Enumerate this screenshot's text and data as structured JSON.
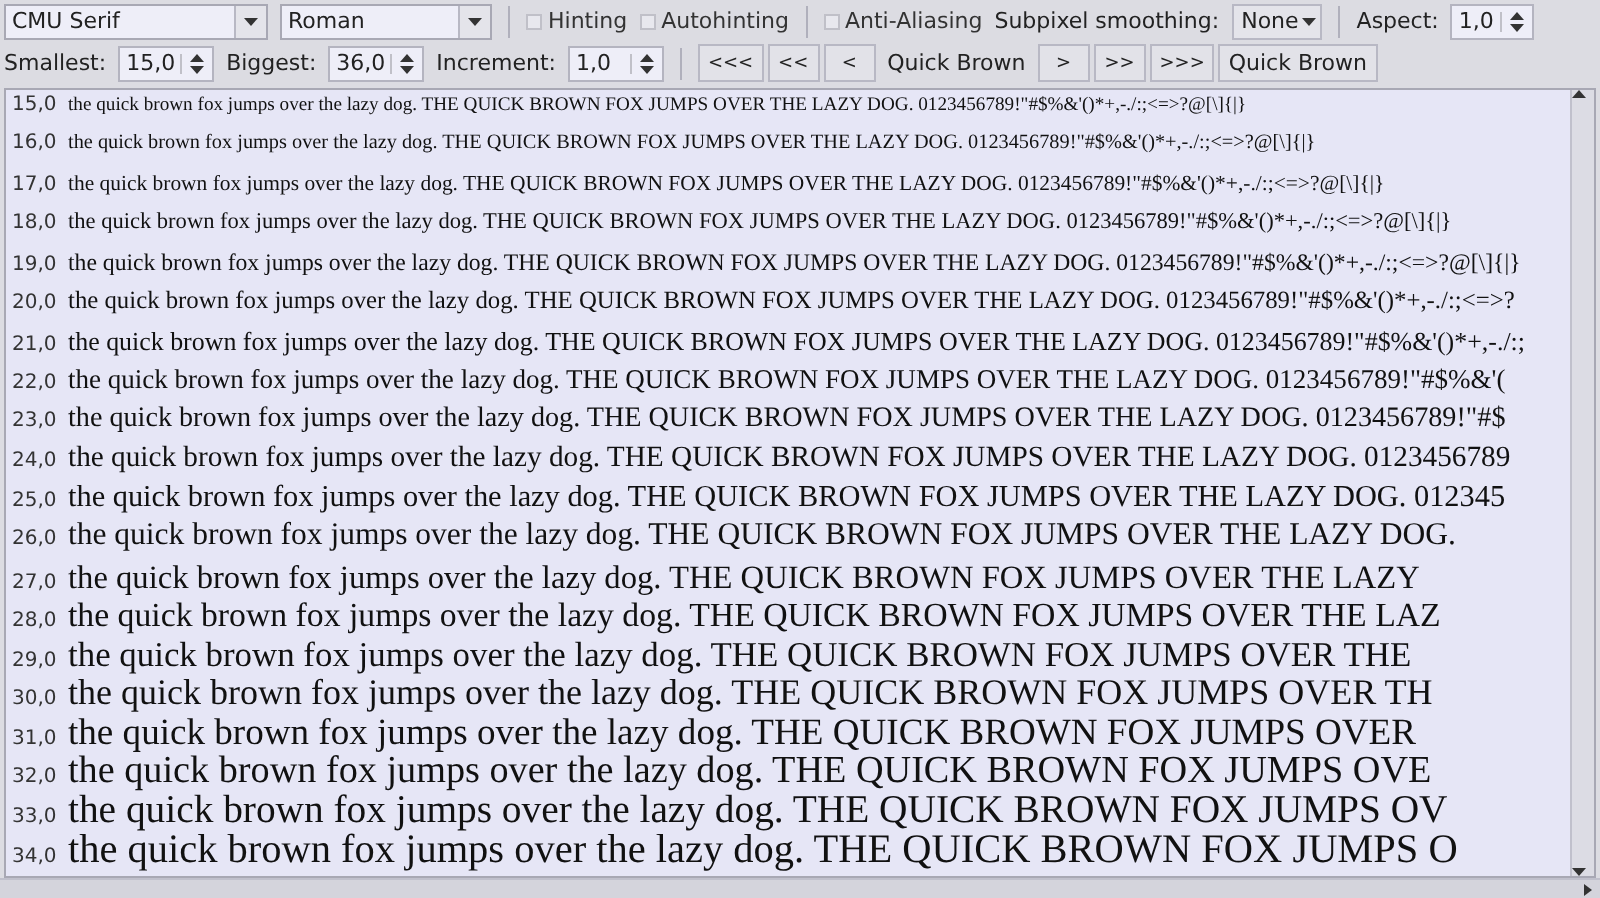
{
  "toolbar_top": {
    "font_combo": {
      "value": "CMU Serif"
    },
    "style_combo": {
      "value": "Roman"
    },
    "checkboxes": [
      {
        "label": "Hinting",
        "checked": false
      },
      {
        "label": "Autohinting",
        "checked": false
      },
      {
        "label": "Anti-Aliasing",
        "checked": false
      }
    ],
    "subpixel": {
      "label": "Subpixel smoothing:",
      "value": "None"
    },
    "aspect": {
      "label": "Aspect:",
      "value": "1,0"
    }
  },
  "toolbar_bottom": {
    "spinboxes": [
      {
        "label": "Smallest:",
        "value": "15,0"
      },
      {
        "label": "Biggest:",
        "value": "36,0"
      },
      {
        "label": "Increment:",
        "value": "1,0"
      }
    ],
    "back_buttons": [
      "<<<",
      "<<",
      "<"
    ],
    "sample_text": "Quick Brown",
    "forward_buttons": [
      ">",
      ">>",
      ">>>"
    ],
    "text_button": "Quick Brown"
  },
  "samples": [
    {
      "size": "15,0",
      "text": "the quick brown fox jumps over the lazy dog. THE QUICK BROWN FOX JUMPS OVER THE LAZY DOG. 0123456789!\"#$%&'()*+,-./:;<=>?@[\\]{|}"
    },
    {
      "size": "16,0",
      "text": "the quick brown fox jumps over the lazy dog. THE QUICK BROWN FOX JUMPS OVER THE LAZY DOG. 0123456789!\"#$%&'()*+,-./:;<=>?@[\\]{|}"
    },
    {
      "size": "17,0",
      "text": "the quick brown fox jumps over the lazy dog. THE QUICK BROWN FOX JUMPS OVER THE LAZY DOG. 0123456789!\"#$%&'()*+,-./:;<=>?@[\\]{|}"
    },
    {
      "size": "18,0",
      "text": "the quick brown fox jumps over the lazy dog. THE QUICK BROWN FOX JUMPS OVER THE LAZY DOG. 0123456789!\"#$%&'()*+,-./:;<=>?@[\\]{|}"
    },
    {
      "size": "19,0",
      "text": "the quick brown fox jumps over the lazy dog. THE QUICK BROWN FOX JUMPS OVER THE LAZY DOG. 0123456789!\"#$%&'()*+,-./:;<=>?@[\\]{|}"
    },
    {
      "size": "20,0",
      "text": "the quick brown fox jumps over the lazy dog. THE QUICK BROWN FOX JUMPS OVER THE LAZY DOG. 0123456789!\"#$%&'()*+,-./:;<=>?"
    },
    {
      "size": "21,0",
      "text": "the quick brown fox jumps over the lazy dog. THE QUICK BROWN FOX JUMPS OVER THE LAZY DOG. 0123456789!\"#$%&'()*+,-./:;"
    },
    {
      "size": "22,0",
      "text": "the quick brown fox jumps over the lazy dog. THE QUICK BROWN FOX JUMPS OVER THE LAZY DOG. 0123456789!\"#$%&'("
    },
    {
      "size": "23,0",
      "text": "the quick brown fox jumps over the lazy dog. THE QUICK BROWN FOX JUMPS OVER THE LAZY DOG. 0123456789!\"#$"
    },
    {
      "size": "24,0",
      "text": "the quick brown fox jumps over the lazy dog. THE QUICK BROWN FOX JUMPS OVER THE LAZY DOG. 0123456789"
    },
    {
      "size": "25,0",
      "text": "the quick brown fox jumps over the lazy dog. THE QUICK BROWN FOX JUMPS OVER THE LAZY DOG. 012345"
    },
    {
      "size": "26,0",
      "text": "the quick brown fox jumps over the lazy dog. THE QUICK BROWN FOX JUMPS OVER THE LAZY DOG."
    },
    {
      "size": "27,0",
      "text": "the quick brown fox jumps over the lazy dog. THE QUICK BROWN FOX JUMPS OVER THE LAZY"
    },
    {
      "size": "28,0",
      "text": "the quick brown fox jumps over the lazy dog. THE QUICK BROWN FOX JUMPS OVER THE LAZ"
    },
    {
      "size": "29,0",
      "text": "the quick brown fox jumps over the lazy dog. THE QUICK BROWN FOX JUMPS OVER THE"
    },
    {
      "size": "30,0",
      "text": "the quick brown fox jumps over the lazy dog. THE QUICK BROWN FOX JUMPS OVER TH"
    },
    {
      "size": "31,0",
      "text": "the quick brown fox jumps over the lazy dog. THE QUICK BROWN FOX JUMPS OVER"
    },
    {
      "size": "32,0",
      "text": "the quick brown fox jumps over the lazy dog. THE QUICK BROWN FOX JUMPS OVE"
    },
    {
      "size": "33,0",
      "text": "the quick brown fox jumps over the lazy dog. THE QUICK BROWN FOX JUMPS OV"
    },
    {
      "size": "34,0",
      "text": "the quick brown fox jumps over the lazy dog. THE QUICK BROWN FOX JUMPS O"
    }
  ]
}
